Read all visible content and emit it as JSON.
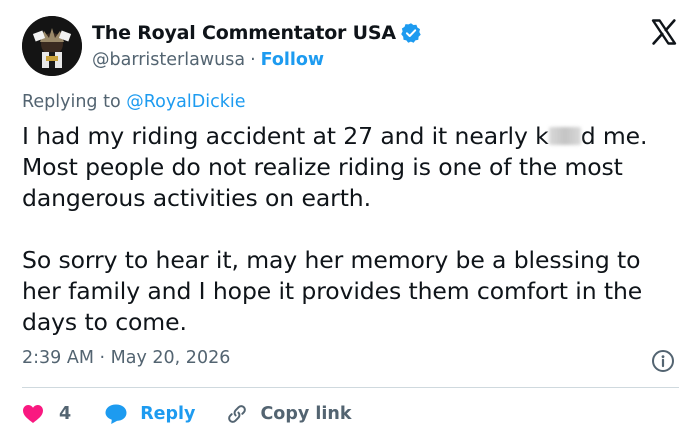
{
  "author": {
    "display_name": "The Royal Commentator USA",
    "handle": "@barristerlawusa",
    "separator": "·",
    "follow_label": "Follow",
    "avatar_icon": "avatar-icon",
    "verified_icon": "verified-badge-icon"
  },
  "platform": {
    "logo_icon": "x-logo-icon"
  },
  "reply_context": {
    "prefix": "Replying to",
    "mention": "@RoyalDickie"
  },
  "tweet": {
    "line1_before_redaction": "I had my riding accident at 27 and it nearly k",
    "line1_after_redaction": "d",
    "line1_rest": " me. Most people do not realize riding is one of the most dangerous activities on earth.",
    "paragraph2": "So sorry to hear it, may her memory be a blessing to her family and I hope it provides them comfort in the days to come."
  },
  "meta": {
    "time": "2:39 AM",
    "separator": "·",
    "date": "May 20, 2026",
    "info_icon": "info-icon"
  },
  "actions": {
    "like_icon": "heart-icon",
    "like_count": "4",
    "reply_icon": "reply-bubble-icon",
    "reply_label": "Reply",
    "copy_icon": "link-icon",
    "copy_label": "Copy link"
  },
  "colors": {
    "accent": "#1d9bf0",
    "text": "#0f1419",
    "secondary": "#536471",
    "like": "#f91880",
    "divider": "#cfd9de"
  }
}
